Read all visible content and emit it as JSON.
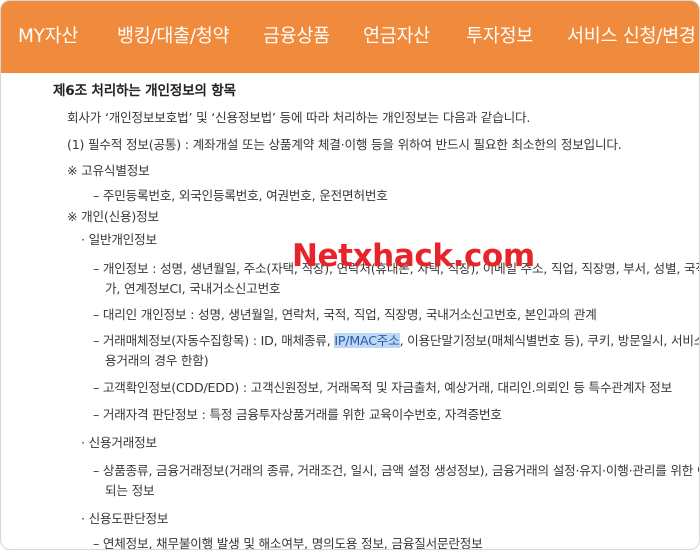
{
  "nav": {
    "items": [
      "MY자산",
      "뱅킹/대출/청약",
      "금융상품",
      "연금자산",
      "투자정보",
      "서비스 신청/변경"
    ],
    "background_color": "#f08a3c"
  },
  "article": {
    "title": "제6조 처리하는 개인정보의 항목",
    "intro": "회사가 ‘개인정보보호법’ 및 ‘신용정보법’ 등에 따라 처리하는 개인정보는 다음과 같습니다.",
    "section1": "(1) 필수적 정보(공통) : 계좌개설 또는 상품계약 체결·이행 등을 위하여 반드시 필요한 최소한의 정보입니다.",
    "unique_id_head": "※ 고유식별정보",
    "unique_id_item": "– 주민등록번호, 외국인등록번호, 여권번호, 운전면허번호",
    "personal_credit_head": "※ 개인(신용)정보",
    "general_head": "· 일반개인정보",
    "personal_info_1": "– 개인정보 : 성명, 생년월일, 주소(자택, 직장), 연락처(휴대폰, 자택, 직장), 이메일 주소, 직업, 직장명, 부서, 성별, 국적,",
    "personal_info_2": "가, 연계정보CI, 국내거소신고번호",
    "agent_info": "– 대리인 개인정보 : 성명, 생년월일, 연락처, 국적, 직업, 직장명, 국내거소신고번호, 본인과의 관계",
    "trade_media_1_a": "– 거래매체정보(자동수집항목) : ID, 매체종류, ",
    "trade_media_1_hl": "IP/MAC주소",
    "trade_media_1_b": ", 이용단말기정보(매체식별번호 등), 쿠키, 방문일시, 서비스",
    "trade_media_2": "용거래의 경우 한함)",
    "cdd_info": "– 고객확인정보(CDD/EDD) : 고객신원정보, 거래목적 및 자금출처, 예상거래, 대리인.의뢰인 등 특수관계자 정보",
    "qualification_info": "– 거래자격 판단정보 : 특정 금융투자상품거래를 위한 교육이수번호, 자격증번호",
    "credit_trade_head": "· 신용거래정보",
    "credit_trade_1": "– 상품종류, 금융거래정보(거래의 종류, 거래조건, 일시, 금액 설정 생성정보), 금융거래의 설정·유지·이행·관리를 위한 이",
    "credit_trade_2": "되는 정보",
    "credit_judge_head": "· 신용도판단정보",
    "credit_judge_1": "– 연체정보, 채무불이행 발생 및 해소여부, 명의도용 정보, 금융질서문란정보"
  },
  "watermark": "Netxhack.com",
  "colors": {
    "highlight_bg": "#bcd8f5",
    "highlight_text": "#2b59a8",
    "watermark": "#e8242b"
  }
}
